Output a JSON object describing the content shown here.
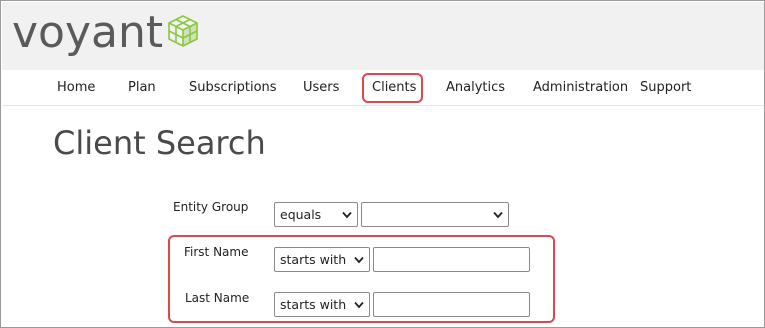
{
  "header": {
    "logo_text": "voyant",
    "logo_icon": "cube-logo-icon"
  },
  "nav": {
    "items": [
      {
        "label": "Home"
      },
      {
        "label": "Plan"
      },
      {
        "label": "Subscriptions"
      },
      {
        "label": "Users"
      },
      {
        "label": "Clients",
        "highlighted": true
      },
      {
        "label": "Analytics"
      },
      {
        "label": "Administration"
      },
      {
        "label": "Support"
      }
    ]
  },
  "main": {
    "title": "Client Search",
    "fields": {
      "entity_group": {
        "label": "Entity Group",
        "operator": "equals",
        "value": ""
      },
      "first_name": {
        "label": "First Name",
        "operator": "starts with",
        "value": ""
      },
      "last_name": {
        "label": "Last Name",
        "operator": "starts with",
        "value": ""
      }
    }
  },
  "colors": {
    "highlight": "#e0474c",
    "logo_green": "#8dc63f",
    "header_bg": "#f1f1f1"
  }
}
